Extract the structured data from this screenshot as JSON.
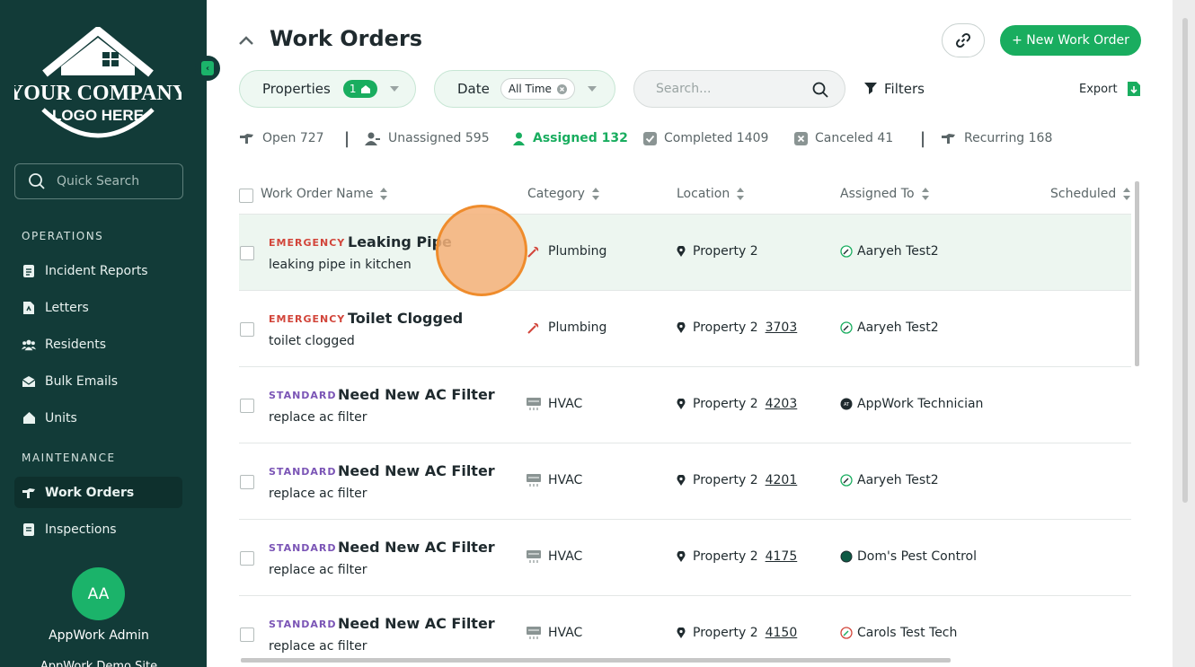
{
  "sidebar": {
    "logo_line1": "YOUR COMPANY",
    "logo_line2": "LOGO HERE",
    "quick_search_placeholder": "Quick Search",
    "operations_title": "OPERATIONS",
    "operations_items": [
      {
        "label": "Incident Reports",
        "icon": "document-icon"
      },
      {
        "label": "Letters",
        "icon": "letter-icon"
      },
      {
        "label": "Residents",
        "icon": "people-icon"
      },
      {
        "label": "Bulk Emails",
        "icon": "envelope-icon"
      },
      {
        "label": "Units",
        "icon": "home-icon"
      }
    ],
    "maintenance_title": "MAINTENANCE",
    "maintenance_items": [
      {
        "label": "Work Orders",
        "icon": "wrench-hand-icon",
        "active": true
      },
      {
        "label": "Inspections",
        "icon": "clipboard-icon"
      }
    ],
    "user": {
      "initials": "AA",
      "name": "AppWork Admin",
      "sub": "AppWork Demo Site"
    },
    "colors": {
      "background": "#123b38",
      "accent": "#1bb36a"
    }
  },
  "header": {
    "title": "Work Orders",
    "new_button": "+ New Work Order"
  },
  "filters": {
    "properties_label": "Properties",
    "properties_count": "1",
    "date_label": "Date",
    "date_value": "All Time",
    "search_placeholder": "Search...",
    "filters_label": "Filters",
    "export_label": "Export"
  },
  "status_tabs": [
    {
      "label": "Open 727",
      "icon": "wrench-hand-icon"
    },
    {
      "label": "Unassigned 595",
      "icon": "person-minus-icon"
    },
    {
      "label": "Assigned 132",
      "icon": "person-icon",
      "active": true
    },
    {
      "label": "Completed 1409",
      "icon": "check-square-icon"
    },
    {
      "label": "Canceled 41",
      "icon": "x-square-icon"
    },
    {
      "label": "Recurring 168",
      "icon": "wrench-hand-icon"
    }
  ],
  "table": {
    "columns": [
      "Work Order Name",
      "Category",
      "Location",
      "Assigned To",
      "Scheduled"
    ],
    "rows": [
      {
        "priority": "EMERGENCY",
        "name": "Leaking Pipe",
        "desc": "leaking pipe in kitchen",
        "category": "Plumbing",
        "property": "Property 2",
        "unit": "",
        "assigned": "Aaryeh Test2"
      },
      {
        "priority": "EMERGENCY",
        "name": "Toilet Clogged",
        "desc": "toilet clogged",
        "category": "Plumbing",
        "property": "Property 2",
        "unit": "3703",
        "assigned": "Aaryeh Test2"
      },
      {
        "priority": "STANDARD",
        "name": "Need New AC Filter",
        "desc": "replace ac filter",
        "category": "HVAC",
        "property": "Property 2",
        "unit": "4203",
        "assigned": "AppWork Technician"
      },
      {
        "priority": "STANDARD",
        "name": "Need New AC Filter",
        "desc": "replace ac filter",
        "category": "HVAC",
        "property": "Property 2",
        "unit": "4201",
        "assigned": "Aaryeh Test2"
      },
      {
        "priority": "STANDARD",
        "name": "Need New AC Filter",
        "desc": "replace ac filter",
        "category": "HVAC",
        "property": "Property 2",
        "unit": "4175",
        "assigned": "Dom's Pest Control"
      },
      {
        "priority": "STANDARD",
        "name": "Need New AC Filter",
        "desc": "replace ac filter",
        "category": "HVAC",
        "property": "Property 2",
        "unit": "4150",
        "assigned": "Carols Test Tech"
      }
    ]
  },
  "colors": {
    "primary": "#19ad5f",
    "emergency": "#d2453a",
    "standard": "#7b55b6"
  }
}
